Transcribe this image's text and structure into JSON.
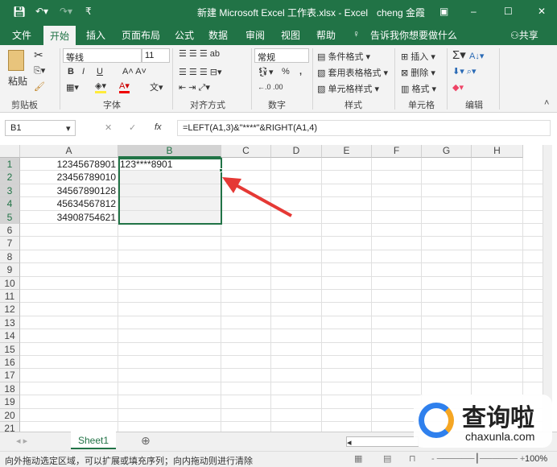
{
  "title": {
    "text": "新建 Microsoft Excel 工作表.xlsx  -  Excel",
    "user": "cheng 金霞"
  },
  "tabs": [
    "文件",
    "开始",
    "插入",
    "页面布局",
    "公式",
    "数据",
    "审阅",
    "视图",
    "帮助"
  ],
  "tell_me": "告诉我你想要做什么",
  "share": "共享",
  "ribbon": {
    "paste": "粘贴",
    "font_name": "等线",
    "font_size": "11",
    "bold": "B",
    "italic": "I",
    "underline": "U",
    "number_format": "常规",
    "percent": "%",
    "comma": ",",
    "cond_format": "条件格式",
    "table_format": "套用表格格式",
    "cell_style": "单元格样式",
    "insert": "插入",
    "delete": "删除",
    "format": "格式",
    "groups": [
      "剪贴板",
      "字体",
      "对齐方式",
      "数字",
      "样式",
      "单元格",
      "编辑"
    ]
  },
  "formula_bar": {
    "name_box": "B1",
    "fx": "fx",
    "formula": "=LEFT(A1,3)&\"****\"&RIGHT(A1,4)"
  },
  "columns": [
    "A",
    "B",
    "C",
    "D",
    "E",
    "F",
    "G",
    "H"
  ],
  "rows": [
    "1",
    "2",
    "3",
    "4",
    "5",
    "6",
    "7",
    "8",
    "9",
    "10",
    "11",
    "12",
    "13",
    "14",
    "15",
    "16",
    "17",
    "18",
    "19",
    "20",
    "21"
  ],
  "cells": {
    "A": [
      "12345678901",
      "23456789010",
      "34567890128",
      "45634567812",
      "34908754621"
    ],
    "B": [
      "123****8901"
    ]
  },
  "sheet_tab": "Sheet1",
  "status": {
    "message": "向外拖动选定区域，可以扩展或填充序列；向内拖动则进行清除",
    "zoom": "100%"
  },
  "watermark": {
    "brand": "查询啦",
    "url": "chaxunla.com"
  },
  "colors": {
    "accent": "#217346",
    "selection": "#217346",
    "arrow": "#e53935"
  }
}
